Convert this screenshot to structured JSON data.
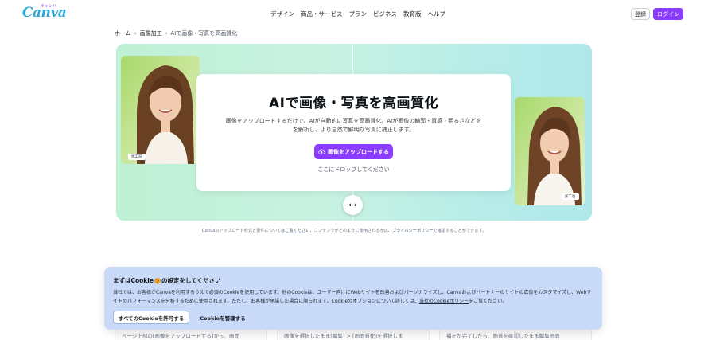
{
  "header": {
    "logo": "Canva",
    "logo_sub": "キャンバ",
    "nav": [
      "デザイン",
      "商品・サービス",
      "プラン",
      "ビジネス",
      "教育版",
      "ヘルプ"
    ],
    "register_label": "登録",
    "login_label": "ログイン"
  },
  "breadcrumb": {
    "items": [
      "ホーム",
      "画像加工",
      "AIで画像・写真を高画質化"
    ]
  },
  "hero": {
    "title": "AIで画像・写真を高画質化",
    "description_line1": "画像をアップロードするだけで、AIが自動的に写真を高画質化。AIが画像の輪郭・質感・明るさなどを",
    "description_line2": "を解析し、より自然で鮮明な写真に補正します。",
    "upload_label": "画像をアップロードする",
    "drop_text": "ここにドロップしてください",
    "tag_before": "加工前",
    "tag_after": "加工後",
    "slider_glyph": "‹ ›",
    "colors": {
      "accent": "#8b3dff"
    }
  },
  "note": {
    "prefix": "Canvaのアップロード形式と要件については",
    "link1": "ご覧ください",
    "middle": "。コンテンツがどのように使用されるかは、",
    "link2": "プライバシーポリシー",
    "suffix": "で確認することができます。"
  },
  "cookie": {
    "title_prefix": "まずはCookie",
    "title_suffix": "の設定をしてください",
    "body_main": "当社では、お客様がCanvaを利用するうえで必須のCookieを使用しています。他のCookieは、ユーザー向けにWebサイトを改善およびパーソナライズし、Canvaおよびパートナーのサイトの広告をカスタマイズし、Webサイトのパフォーマンスを分析するために使用されます。ただし、お客様が承諾した場合に限られます。Cookieのオプションについて詳しくは、",
    "body_link": "当社のCookieポリシー",
    "body_end": "をご覧ください。",
    "allow_label": "すべてのCookieを許可する",
    "manage_label": "Cookieを管理する"
  },
  "steps": [
    "ページ上部の[画像をアップロードする]から、画面",
    "画像を選択したまま[編集] > [画面質化]を選択しま",
    "補正が完了したら、画質を確認したまま編集画面"
  ]
}
